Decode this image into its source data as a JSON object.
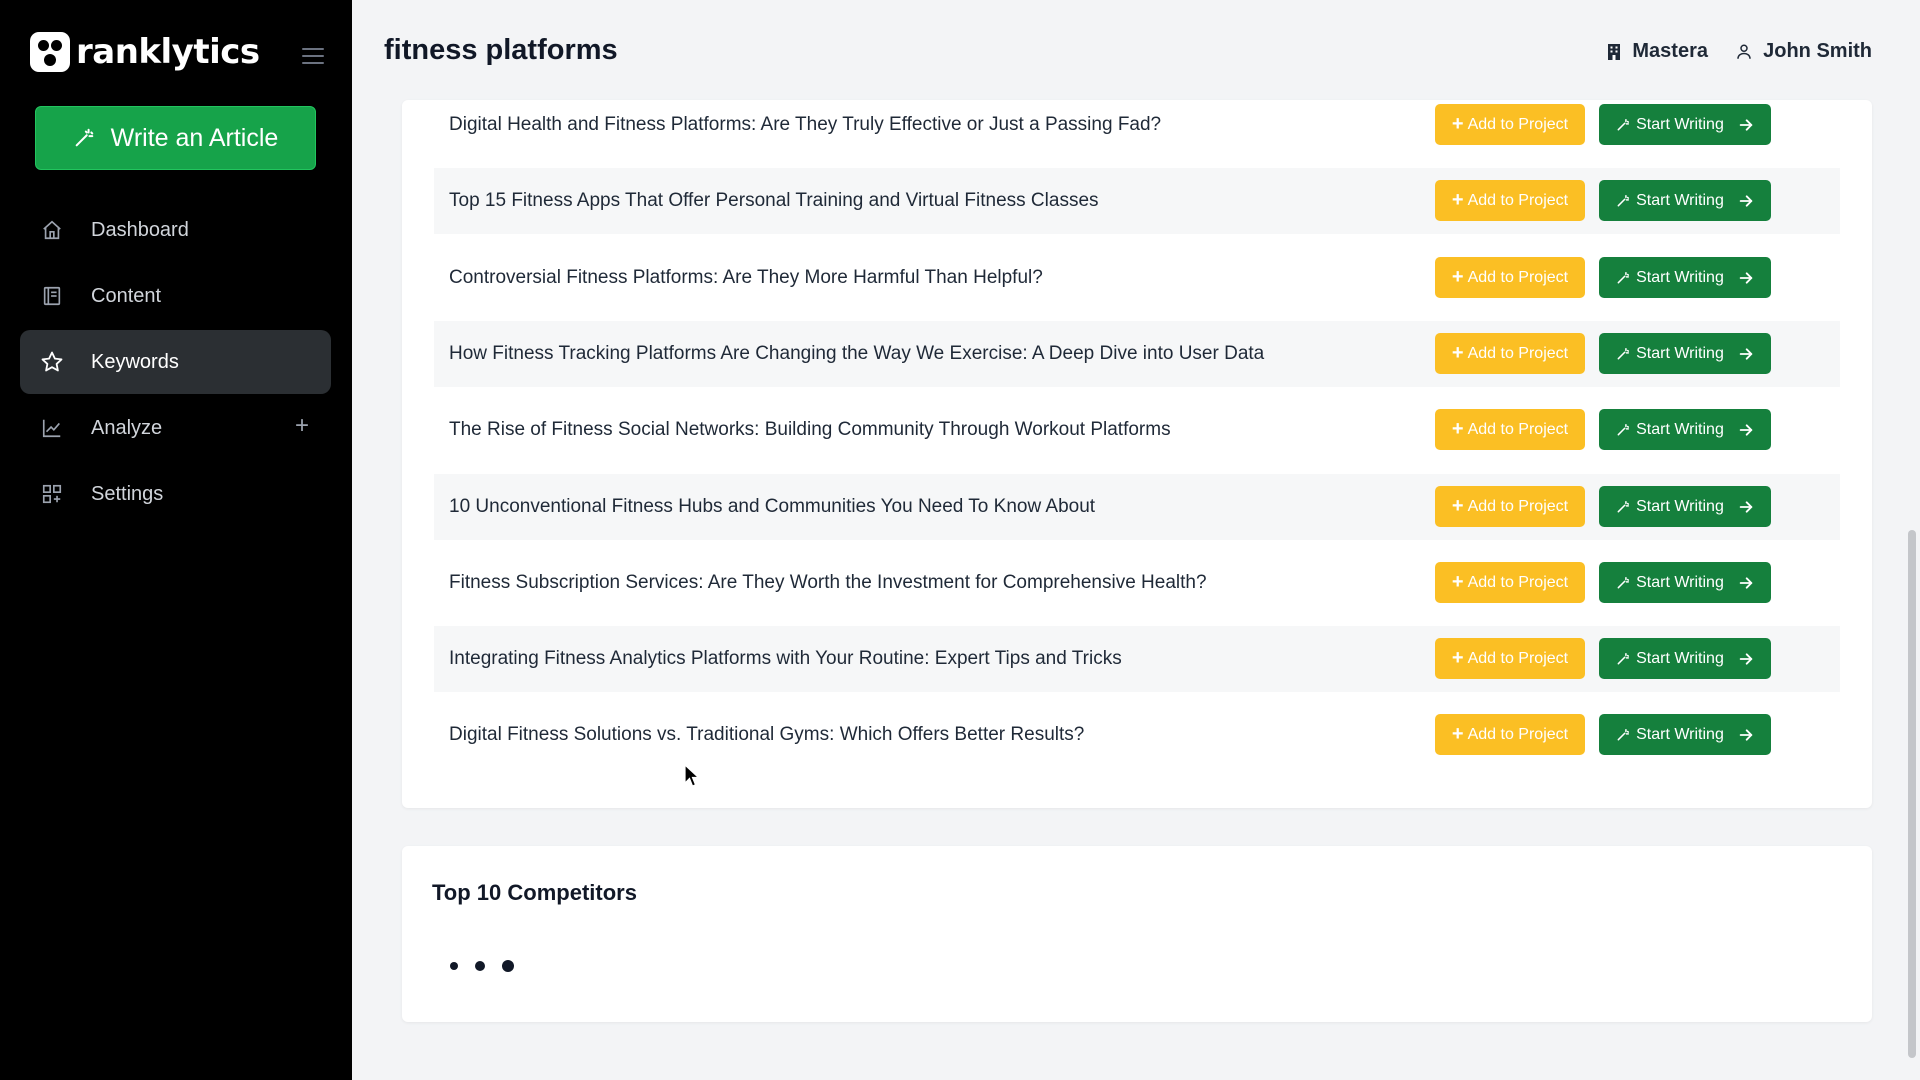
{
  "app": {
    "brand": "ranklytics",
    "write_button": "Write an Article"
  },
  "nav": [
    {
      "label": "Dashboard",
      "icon": "home-icon"
    },
    {
      "label": "Content",
      "icon": "document-icon"
    },
    {
      "label": "Keywords",
      "icon": "star-icon",
      "active": true
    },
    {
      "label": "Analyze",
      "icon": "chart-line-icon",
      "expand": "+"
    },
    {
      "label": "Settings",
      "icon": "grid-icon"
    }
  ],
  "header": {
    "title": "fitness platforms",
    "organization": "Mastera",
    "user": "John Smith"
  },
  "articles": {
    "add_label": "Add to Project",
    "write_label": "Start Writing",
    "items": [
      "Digital Health and Fitness Platforms: Are They Truly Effective or Just a Passing Fad?",
      "Top 15 Fitness Apps That Offer Personal Training and Virtual Fitness Classes",
      "Controversial Fitness Platforms: Are They More Harmful Than Helpful?",
      "How Fitness Tracking Platforms Are Changing the Way We Exercise: A Deep Dive into User Data",
      "The Rise of Fitness Social Networks: Building Community Through Workout Platforms",
      "10 Unconventional Fitness Hubs and Communities You Need To Know About",
      "Fitness Subscription Services: Are They Worth the Investment for Comprehensive Health?",
      "Integrating Fitness Analytics Platforms with Your Routine: Expert Tips and Tricks",
      "Digital Fitness Solutions vs. Traditional Gyms: Which Offers Better Results?"
    ]
  },
  "competitors": {
    "title": "Top 10 Competitors",
    "status": "loading"
  },
  "colors": {
    "sidebar_bg": "#000000",
    "primary_green": "#16a34a",
    "start_writing_green": "#15803d",
    "add_yellow": "#fbbf24",
    "active_nav_bg": "#2b2f33"
  }
}
